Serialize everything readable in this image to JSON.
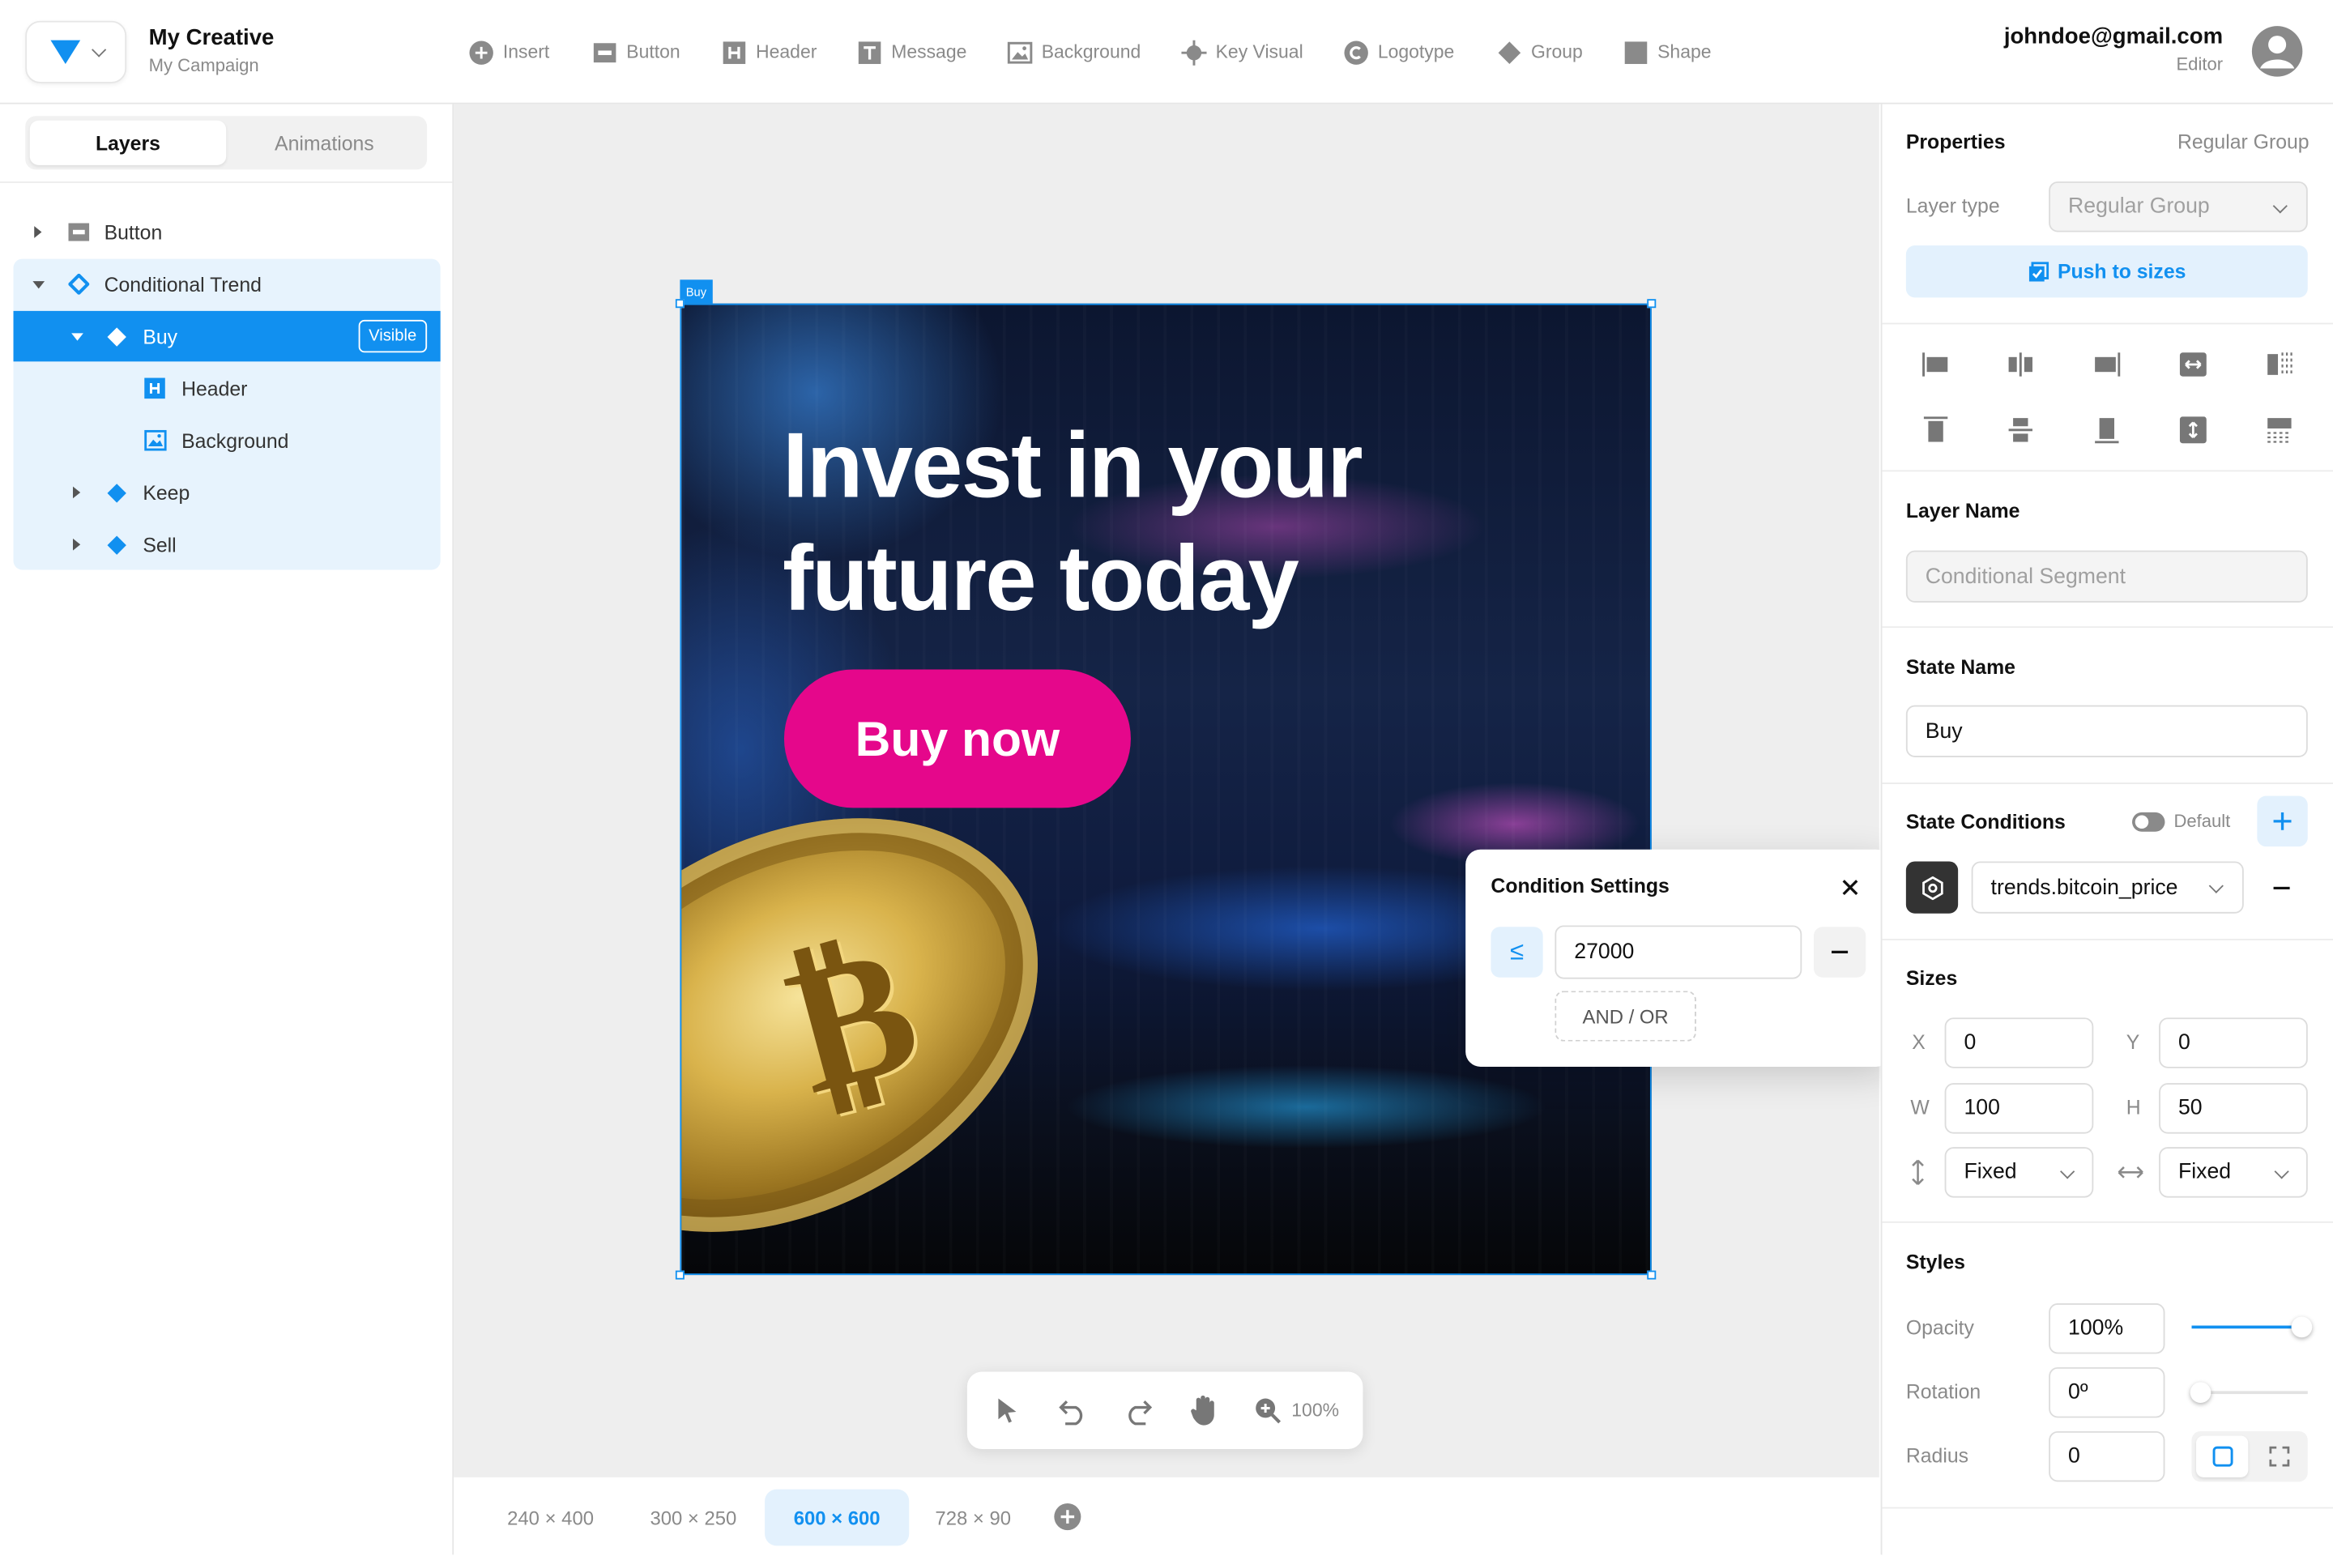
{
  "header": {
    "title": "My Creative",
    "subtitle": "My Campaign",
    "user_email": "johndoe@gmail.com",
    "user_role": "Editor"
  },
  "toolbar": {
    "items": [
      {
        "label": "Insert",
        "icon": "plus-circle-icon"
      },
      {
        "label": "Button",
        "icon": "button-icon"
      },
      {
        "label": "Header",
        "icon": "header-icon"
      },
      {
        "label": "Message",
        "icon": "text-icon"
      },
      {
        "label": "Background",
        "icon": "image-icon"
      },
      {
        "label": "Key Visual",
        "icon": "key-visual-icon"
      },
      {
        "label": "Logotype",
        "icon": "logotype-icon"
      },
      {
        "label": "Group",
        "icon": "group-icon"
      },
      {
        "label": "Shape",
        "icon": "shape-icon"
      }
    ]
  },
  "left_panel": {
    "tabs": [
      "Layers",
      "Animations"
    ],
    "active_tab": "Layers",
    "layers": [
      {
        "label": "Button",
        "icon": "button-icon"
      },
      {
        "label": "Conditional Trend",
        "icon": "conditional-icon"
      },
      {
        "label": "Buy",
        "icon": "diamond-icon",
        "badge": "Visible"
      },
      {
        "label": "Header",
        "icon": "header-icon"
      },
      {
        "label": "Background",
        "icon": "image-icon"
      },
      {
        "label": "Keep",
        "icon": "diamond-icon"
      },
      {
        "label": "Sell",
        "icon": "diamond-icon"
      }
    ]
  },
  "canvas": {
    "selection_label": "Buy",
    "banner": {
      "headline_line1": "Invest in your",
      "headline_line2": "future today",
      "cta": "Buy now"
    },
    "condition_popup": {
      "title": "Condition Settings",
      "operator": "≤",
      "value": "27000",
      "and_or": "AND / OR"
    },
    "tools": {
      "zoom": "100%"
    },
    "sizes": [
      "240 × 400",
      "300 × 250",
      "600 × 600",
      "728 × 90"
    ],
    "active_size": "600 × 600"
  },
  "properties": {
    "title": "Properties",
    "group_type": "Regular Group",
    "layer_type_label": "Layer type",
    "layer_type_value": "Regular Group",
    "push_to_sizes": "Push to sizes",
    "layer_name_title": "Layer Name",
    "layer_name_placeholder": "Conditional Segment",
    "state_name_title": "State Name",
    "state_name_value": "Buy",
    "state_conditions_title": "State Conditions",
    "default_label": "Default",
    "condition_variable": "trends.bitcoin_price",
    "sizes_title": "Sizes",
    "x_label": "X",
    "x_value": "0",
    "y_label": "Y",
    "y_value": "0",
    "w_label": "W",
    "w_value": "100",
    "h_label": "H",
    "h_value": "50",
    "height_mode": "Fixed",
    "width_mode": "Fixed",
    "styles_title": "Styles",
    "opacity_label": "Opacity",
    "opacity_value": "100%",
    "opacity_level": 1.0,
    "rotation_label": "Rotation",
    "rotation_value": "0º",
    "rotation_level": 0.0,
    "radius_label": "Radius",
    "radius_value": "0"
  },
  "colors": {
    "accent": "#1190f0",
    "cta": "#e5078b",
    "selected_row": "#1190f0",
    "group_bg": "#e7f3fd"
  }
}
